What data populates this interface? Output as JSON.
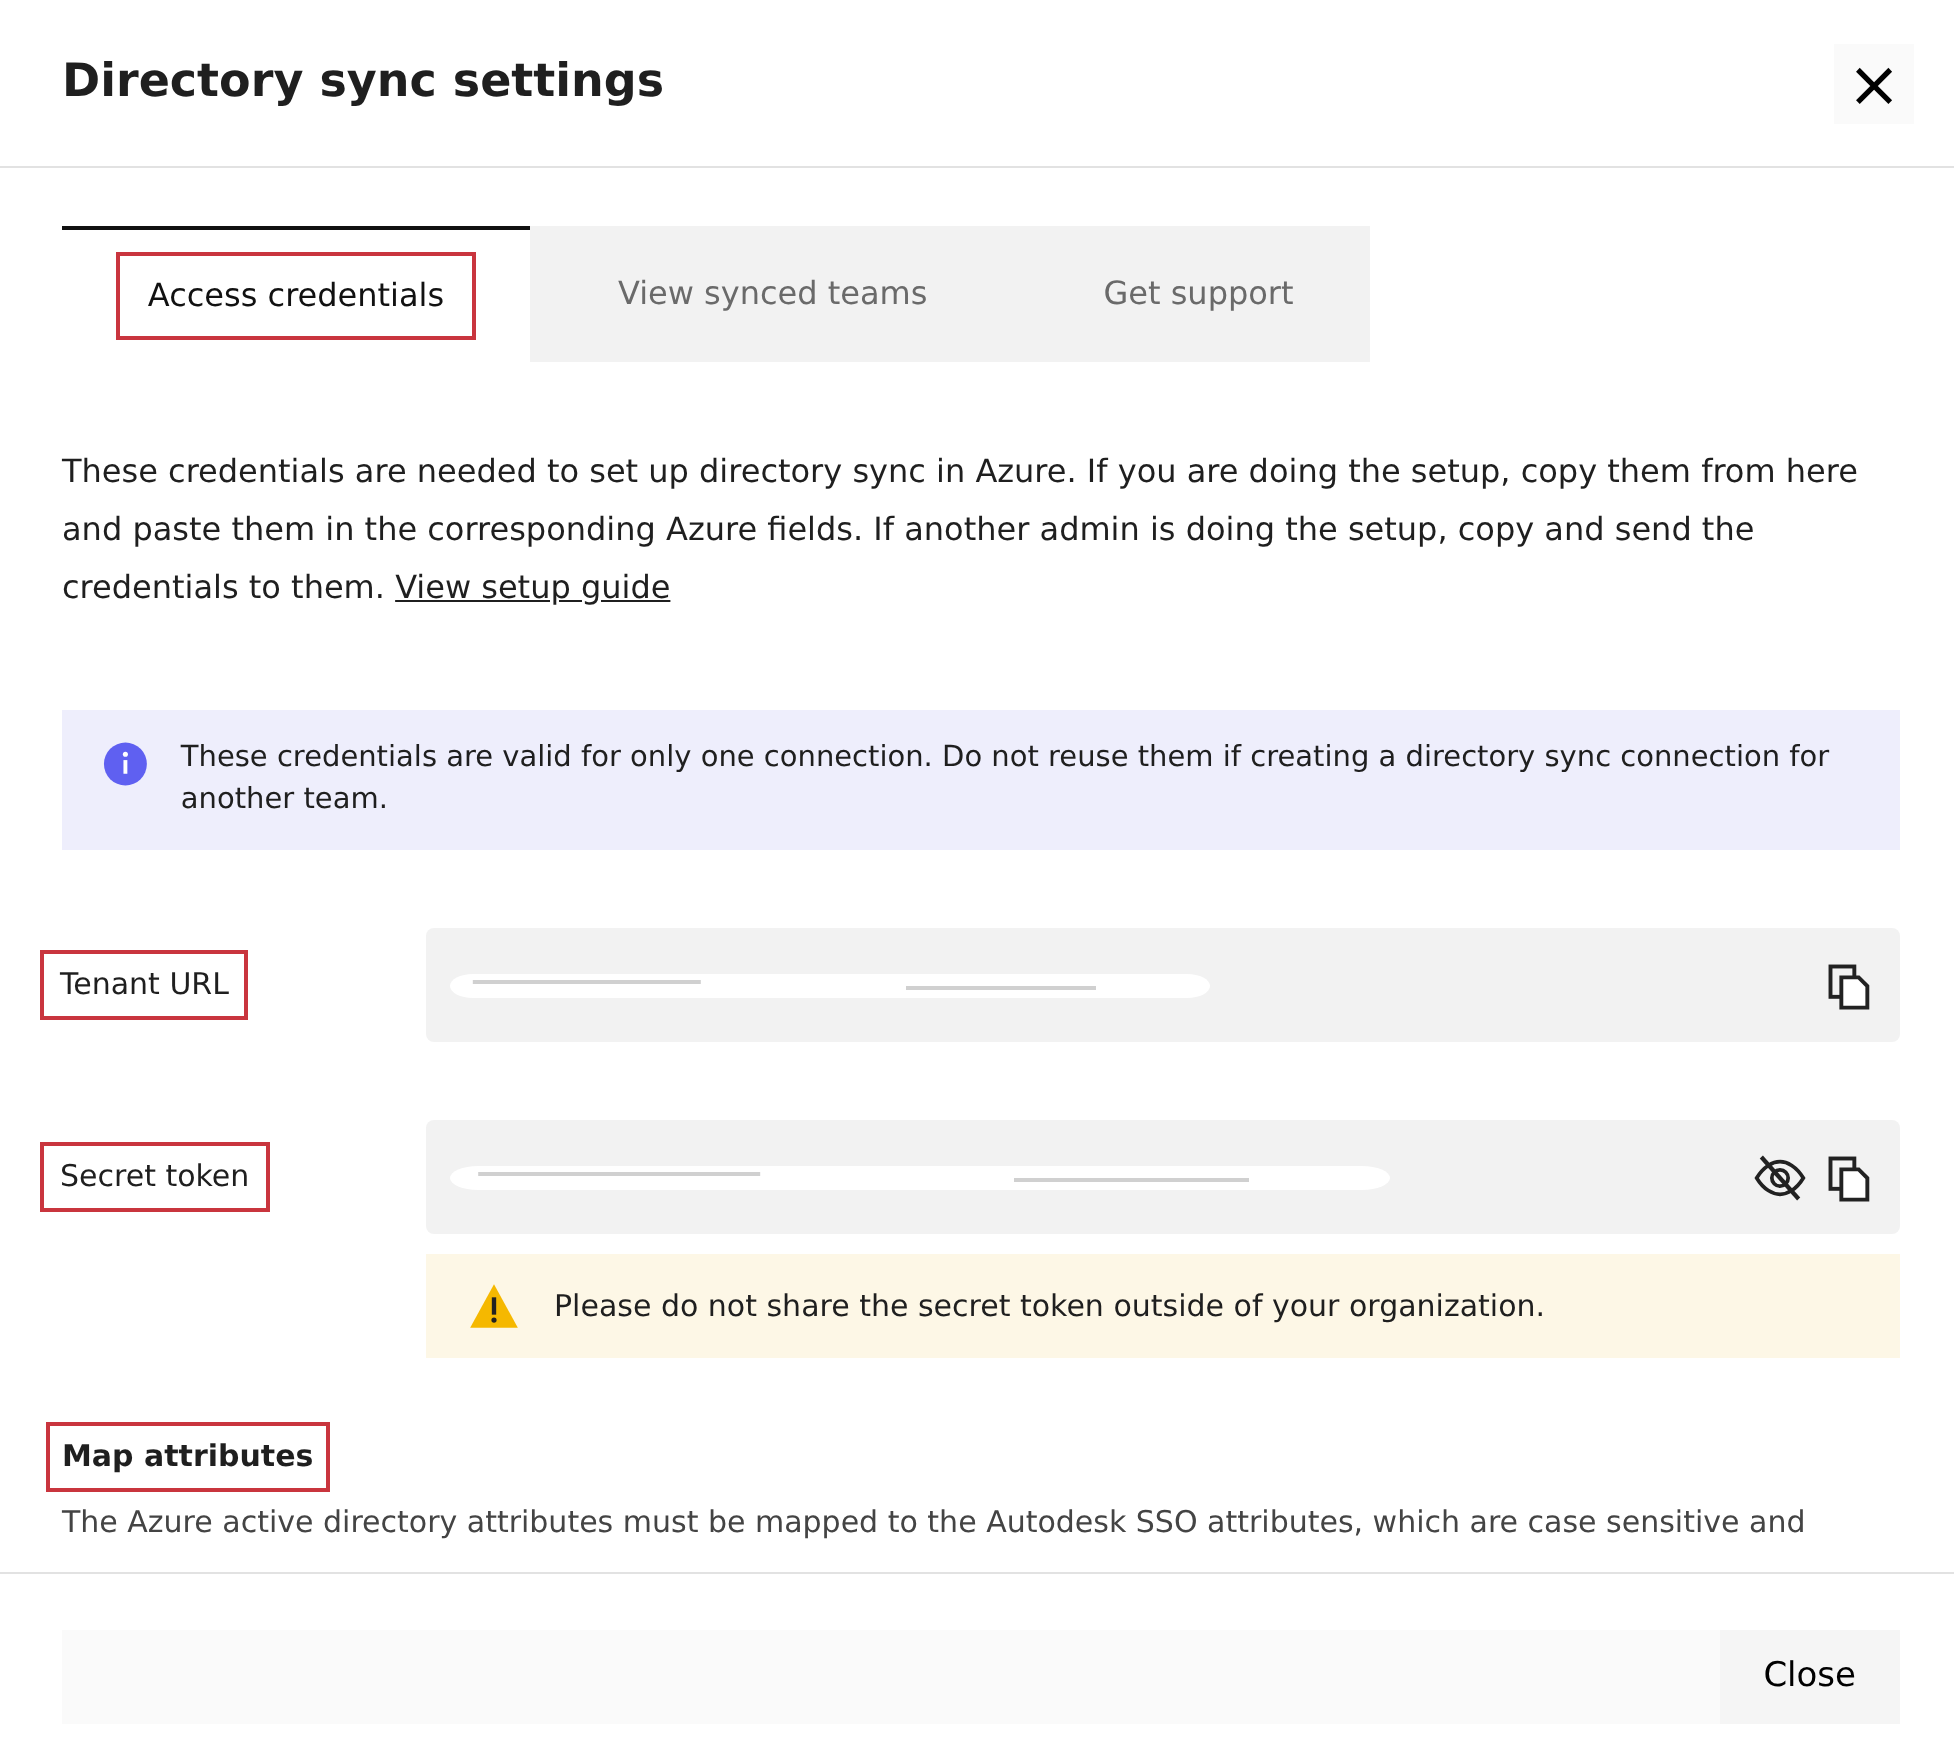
{
  "dialog": {
    "title": "Directory sync settings",
    "close_glyph": "×"
  },
  "tabs": [
    {
      "label": "Access credentials",
      "selected": true,
      "highlighted": true
    },
    {
      "label": "View synced teams",
      "selected": false,
      "highlighted": false
    },
    {
      "label": "Get support",
      "selected": false,
      "highlighted": false
    }
  ],
  "intro": {
    "text": "These credentials are needed to set up directory sync in Azure. If you are doing the setup, copy them from here and paste them in the corresponding Azure fields. If another admin is doing the setup, copy and send the credentials to them.",
    "link": "View setup guide"
  },
  "info_banner": {
    "text": "These credentials are valid for only one connection. Do not reuse them if creating a directory sync connection for another team."
  },
  "fields": [
    {
      "label": "Tenant URL",
      "highlighted": true,
      "redacted": true,
      "hidden_toggle": false
    },
    {
      "label": "Secret token",
      "highlighted": true,
      "redacted": true,
      "hidden_toggle": true
    }
  ],
  "warning_banner": {
    "text": "Please do not share the secret token outside of your organization."
  },
  "map_attributes": {
    "heading": "Map attributes",
    "highlighted": true,
    "text": "The Azure active directory attributes must be mapped to the Autodesk SSO attributes, which are case sensitive and"
  },
  "footer": {
    "button": "Close"
  }
}
